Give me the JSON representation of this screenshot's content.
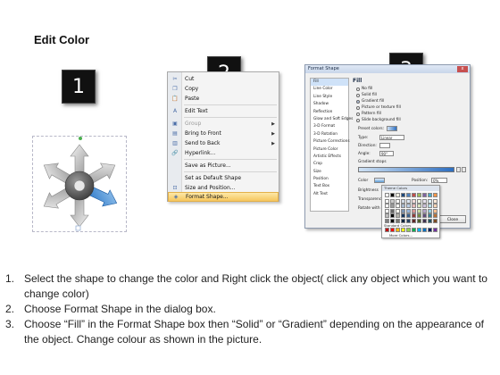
{
  "page": {
    "title": "Edit Color"
  },
  "steps": {
    "one": "1",
    "two": "2",
    "three": "3"
  },
  "context_menu": {
    "items": [
      {
        "label": "Cut",
        "icon": "scissors-icon",
        "glyph": "✂"
      },
      {
        "label": "Copy",
        "icon": "copy-icon",
        "glyph": "❐"
      },
      {
        "label": "Paste",
        "icon": "paste-icon",
        "glyph": "📋"
      },
      {
        "label": "Edit Text",
        "icon": "edit-text-icon",
        "glyph": "A"
      },
      {
        "label": "Group",
        "icon": "group-icon",
        "glyph": "▣"
      },
      {
        "label": "Bring to Front",
        "icon": "bring-front-icon",
        "glyph": "▤"
      },
      {
        "label": "Send to Back",
        "icon": "send-back-icon",
        "glyph": "▥"
      },
      {
        "label": "Hyperlink...",
        "icon": "hyperlink-icon",
        "glyph": "🔗"
      },
      {
        "label": "Save as Picture...",
        "icon": "",
        "glyph": ""
      },
      {
        "label": "Set as Default Shape",
        "icon": "",
        "glyph": ""
      },
      {
        "label": "Size and Position...",
        "icon": "size-position-icon",
        "glyph": "⊡"
      },
      {
        "label": "Format Shape...",
        "icon": "format-shape-icon",
        "glyph": "◈"
      }
    ]
  },
  "dialog": {
    "title": "Format Shape",
    "close_glyph": "x",
    "nav": [
      "Fill",
      "Line Color",
      "Line Style",
      "Shadow",
      "Reflection",
      "Glow and Soft Edges",
      "3-D Format",
      "3-D Rotation",
      "Picture Corrections",
      "Picture Color",
      "Artistic Effects",
      "Crop",
      "Size",
      "Position",
      "Text Box",
      "Alt Text"
    ],
    "section": "Fill",
    "options": [
      "No fill",
      "Solid fill",
      "Gradient fill",
      "Picture or texture fill",
      "Pattern fill",
      "Slide background fill"
    ],
    "fields": {
      "preset": "Preset colors:",
      "type": "Type:",
      "type_value": "Linear",
      "direction": "Direction:",
      "angle": "Angle:",
      "angle_value": "90°",
      "gradient_stops": "Gradient stops",
      "color": "Color",
      "position": "Position:",
      "position_value": "0%",
      "brightness": "Brightness",
      "transparency": "Transparency",
      "rotate": "Rotate with shape"
    },
    "close_button": "Close"
  },
  "palette": {
    "theme_label": "Theme Colors",
    "standard_label": "Standard Colors",
    "more_label": "More Colors...",
    "theme_top": [
      "#ffffff",
      "#000000",
      "#eeece1",
      "#1f497d",
      "#4f81bd",
      "#c0504d",
      "#9bbb59",
      "#8064a2",
      "#4bacc6",
      "#f79646"
    ],
    "standard": [
      "#c00000",
      "#ff0000",
      "#ffc000",
      "#ffff00",
      "#92d050",
      "#00b050",
      "#00b0f0",
      "#0070c0",
      "#002060",
      "#7030a0"
    ]
  },
  "instructions": [
    {
      "num": "1.",
      "text": "Select the shape to change the color and Right click the object( click any object which you want to change color)"
    },
    {
      "num": "2.",
      "text": "Choose Format Shape in the dialog box."
    },
    {
      "num": "3.",
      "text": "Choose “Fill” in the Format Shape box then “Solid” or “Gradient” depending on the appearance of the object. Change colour as shown in the picture."
    }
  ]
}
